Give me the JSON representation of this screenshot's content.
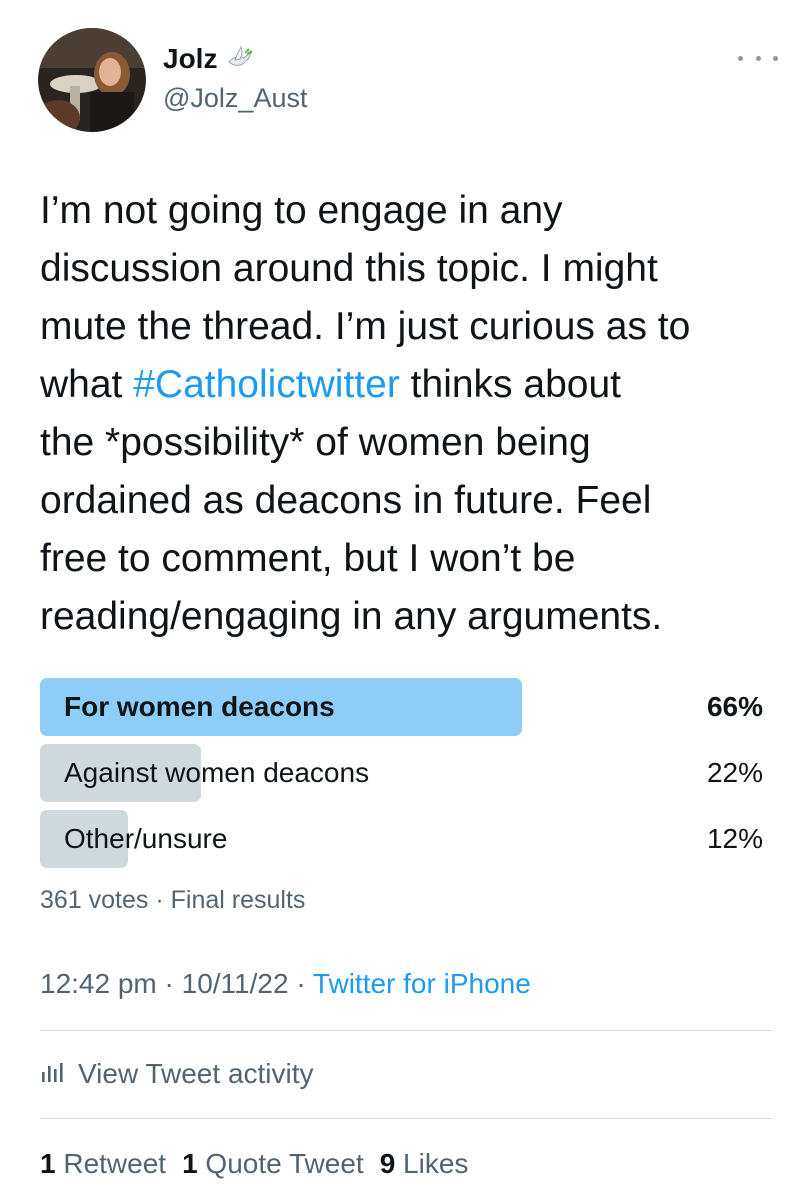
{
  "author": {
    "display_name": "Jolz",
    "name_emoji": "dove-of-peace-icon",
    "handle": "@Jolz_Aust"
  },
  "tweet": {
    "lines": [
      "I’m not going to engage in any",
      "discussion around this topic. I might",
      "mute the thread. I’m just curious as to"
    ],
    "line4_prefix": "what ",
    "hashtag": "#Catholictwitter",
    "line4_suffix": " thinks about",
    "lines_after": [
      "the *possibility* of women being",
      "ordained as deacons in future. Feel",
      "free to comment, but I won’t be",
      "reading/engaging in any arguments."
    ]
  },
  "poll": {
    "options": [
      {
        "label": "For women deacons",
        "percent_text": "66%",
        "percent": 66,
        "winner": true
      },
      {
        "label": "Against women deacons",
        "percent_text": "22%",
        "percent": 22,
        "winner": false
      },
      {
        "label": "Other/unsure",
        "percent_text": "12%",
        "percent": 12,
        "winner": false
      }
    ],
    "footer": "361 votes · Final results"
  },
  "meta": {
    "time_date": "12:42 pm · 10/11/22 · ",
    "client": "Twitter for iPhone"
  },
  "activity": {
    "label": "View Tweet activity",
    "icon": "bar-chart-icon"
  },
  "stats": {
    "retweets_count": "1",
    "retweets_label": " Retweet",
    "quotes_count": "1",
    "quotes_label": " Quote Tweet",
    "likes_count": "9",
    "likes_label": " Likes"
  },
  "colors": {
    "accent": "#1d9bf0",
    "poll_winner_bar": "#8ecdf8",
    "poll_bar": "#cfd9de",
    "secondary_text": "#536471"
  }
}
